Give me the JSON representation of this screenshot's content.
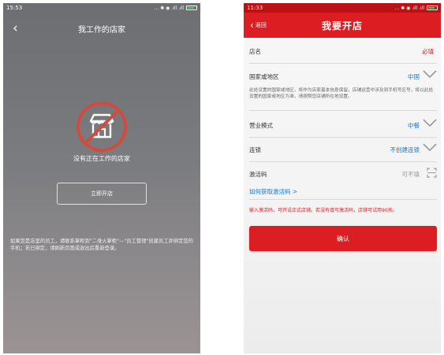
{
  "left": {
    "status": {
      "time": "15:53",
      "signal": "... ✱ ◉ .ıll .ıll"
    },
    "nav": {
      "back_icon": "‹",
      "title": "我工作的店家"
    },
    "empty": {
      "icon": "no-store-icon",
      "text": "没有正在工作的店家"
    },
    "open_button": "立即开店",
    "hint": "如果您是店里的员工，请联系掌柜到\"二维火掌柜\"—\"员工管理\"创建员工并绑定您的手机；若已绑定，请刷新页面或退出后重新登录。"
  },
  "right": {
    "status": {
      "time": "11:33",
      "signal": "... ✱ ◉ .ıll .ıll"
    },
    "nav": {
      "back_label": "返回",
      "title": "我要开店"
    },
    "form": {
      "store_name": {
        "label": "店名",
        "value": "必填"
      },
      "country": {
        "label": "国家或地区",
        "value": "中国"
      },
      "country_note": "此处设置的国家或地区，将作为店家基本信息保留，店铺运营中涉及到手机号区号，将以此处设置的国家或地区为准，请按照您店铺所在地设置。",
      "mode": {
        "label": "营业模式",
        "value": "中餐"
      },
      "chain": {
        "label": "连锁",
        "value": "不创建连锁"
      },
      "activation": {
        "label": "激活码",
        "value": "可不填"
      },
      "activation_link": "如何获取激活码 >",
      "warning": "输入激活码，可开设正式店铺。若没有填写激活码，店铺可试用90天。",
      "confirm": "确认"
    }
  },
  "colors": {
    "brand_red": "#dc1e22",
    "link_blue": "#1a78c8"
  }
}
